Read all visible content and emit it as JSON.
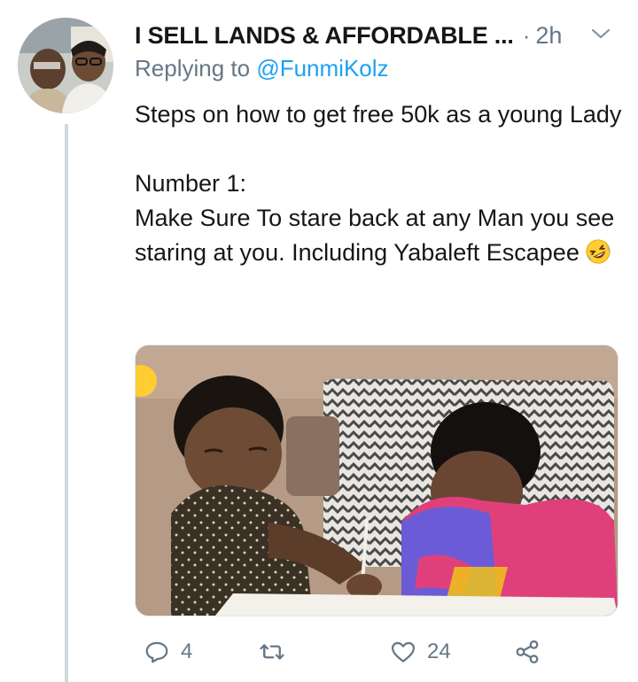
{
  "tweet": {
    "author_name": "I SELL LANDS & AFFORDABLE ...",
    "separator": "·",
    "time": "2h",
    "replying_prefix": "Replying to",
    "replying_handle": "@FunmiKolz",
    "paragraphs": [
      "Steps on how to get free 50k as a young Lady",
      "Number 1:\nMake Sure To stare back at any Man you see staring at you. Including Yabaleft Escapee"
    ],
    "emoji": "rolling-on-floor-laughing",
    "media_description": "two children at a desk",
    "actions": {
      "reply_count": "4",
      "retweet_count": "",
      "like_count": "24"
    }
  },
  "colors": {
    "text": "#14171a",
    "secondary": "#657786",
    "link": "#1da1f2",
    "thread_line": "#cfd9de"
  },
  "icons": [
    "chevron-down-icon",
    "reply-icon",
    "retweet-icon",
    "like-icon",
    "share-icon"
  ]
}
